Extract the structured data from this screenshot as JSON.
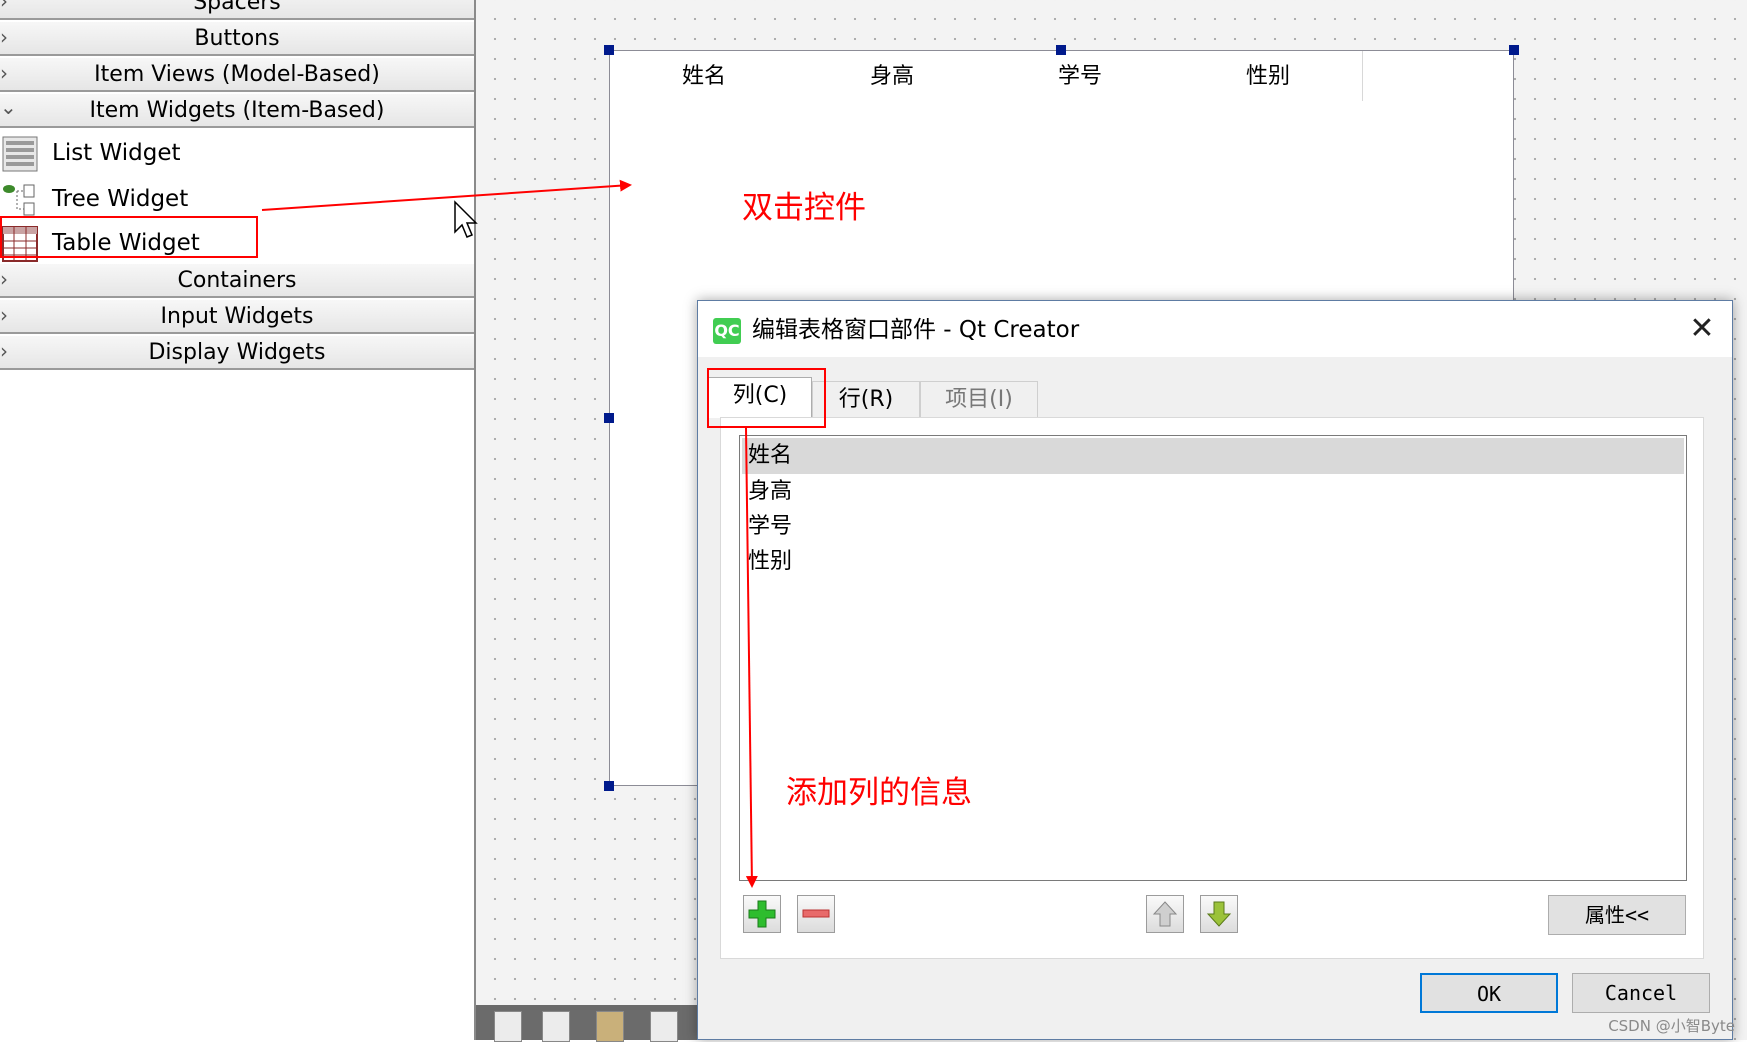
{
  "widget_box": {
    "categories": [
      {
        "label": "Spacers",
        "expanded": false
      },
      {
        "label": "Buttons",
        "expanded": false
      },
      {
        "label": "Item Views (Model-Based)",
        "expanded": false
      },
      {
        "label": "Item Widgets (Item-Based)",
        "expanded": true
      },
      {
        "label": "Containers",
        "expanded": false
      },
      {
        "label": "Input Widgets",
        "expanded": false
      },
      {
        "label": "Display Widgets",
        "expanded": false
      }
    ],
    "items": [
      {
        "label": "List Widget",
        "icon": "list-widget-icon"
      },
      {
        "label": "Tree Widget",
        "icon": "tree-widget-icon"
      },
      {
        "label": "Table Widget",
        "icon": "table-widget-icon"
      }
    ]
  },
  "form": {
    "table_headers": [
      "姓名",
      "身高",
      "学号",
      "性别"
    ]
  },
  "dialog": {
    "title": "编辑表格窗口部件 - Qt Creator",
    "logo_text": "QC",
    "close_glyph": "✕",
    "tabs": [
      "列(C)",
      "行(R)",
      "项目(I)"
    ],
    "columns": [
      "姓名",
      "身高",
      "学号",
      "性别"
    ],
    "selected_column": 0,
    "properties_button": "属性<<",
    "ok_button": "OK",
    "cancel_button": "Cancel"
  },
  "annotations": {
    "double_click": "双击控件",
    "add_column_info": "添加列的信息",
    "color": "#ff0000"
  },
  "watermark": "CSDN @小智Byte",
  "colors": {
    "selection_handle": "#001a8c",
    "qt_green": "#41cd52",
    "ok_border": "#0078d7"
  }
}
